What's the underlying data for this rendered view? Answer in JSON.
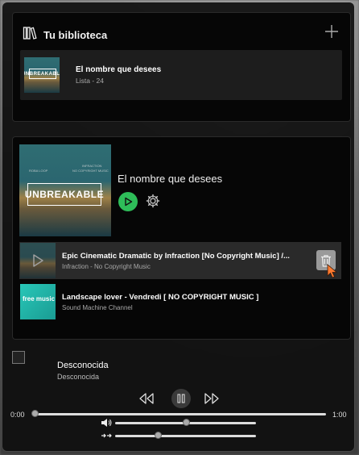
{
  "library": {
    "title": "Tu biblioteca",
    "items": [
      {
        "name": "El nombre que desees",
        "subtitle": "Lista - 24",
        "cover_text": "UNBREAKABLE"
      }
    ]
  },
  "playlist": {
    "title": "El nombre que desees",
    "cover_text": "UNBREAKABLE",
    "cover_small_left": "ROBA LOOP",
    "cover_small_right_1": "INFRACTION",
    "cover_small_right_2": "NO COPYRIGHT MUSIC",
    "tracks": [
      {
        "title": "Epic Cinematic Dramatic by Infraction [No Copyright Music] /...",
        "channel": "Infraction - No Copyright Music",
        "hovered": true
      },
      {
        "title": "Landscape lover - Vendredi [ NO COPYRIGHT MUSIC ]",
        "channel": "Sound Machine Channel",
        "thumb_text": "free music"
      }
    ]
  },
  "now_playing": {
    "title": "Desconocida",
    "artist": "Desconocida",
    "time_current": "0:00",
    "time_total": "1:00",
    "progress": 0,
    "volume": 0.5,
    "speed_position": 0.3
  },
  "colors": {
    "accent_green": "#2ebd59",
    "panel": "#060606",
    "hover_row": "#2a2a2a",
    "cursor": "#ff7a2f"
  }
}
